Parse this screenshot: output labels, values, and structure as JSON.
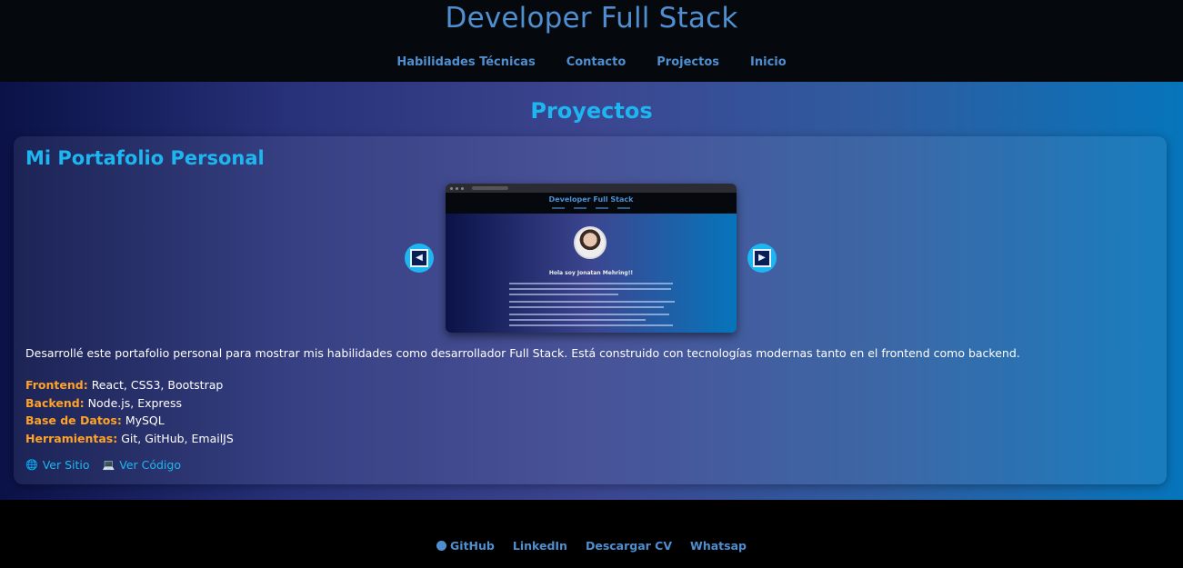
{
  "header": {
    "title": "Developer Full Stack",
    "nav": [
      "Habilidades Técnicas",
      "Contacto",
      "Projectos",
      "Inicio"
    ]
  },
  "section": {
    "title": "Proyectos"
  },
  "project": {
    "title": "Mi Portafolio Personal",
    "screenshot": {
      "title": "Developer Full Stack",
      "greeting": "Hola soy Jonatan Mehring!!"
    },
    "description": "Desarrollé este portafolio personal para mostrar mis habilidades como desarrollador Full Stack. Está construido con tecnologías modernas tanto en el frontend como backend.",
    "tech": [
      {
        "label": "Frontend:",
        "value": "React, CSS3, Bootstrap"
      },
      {
        "label": "Backend:",
        "value": "Node.js, Express"
      },
      {
        "label": "Base de Datos:",
        "value": "MySQL"
      },
      {
        "label": "Herramientas:",
        "value": "Git, GitHub, EmailJS"
      }
    ],
    "links": {
      "site": "Ver Sitio",
      "code": "Ver Código"
    },
    "icons": {
      "site": "globe-icon",
      "code": "laptop-icon",
      "prev": "arrow-left-icon",
      "next": "arrow-right-icon"
    }
  },
  "footer": {
    "links": [
      "GitHub",
      "LinkedIn",
      "Descargar CV",
      "Whatsap"
    ],
    "github_icon": "github-icon"
  },
  "colors": {
    "accent": "#1eb6f0",
    "title": "#4f8fd0",
    "tech_label": "#ffa227"
  }
}
